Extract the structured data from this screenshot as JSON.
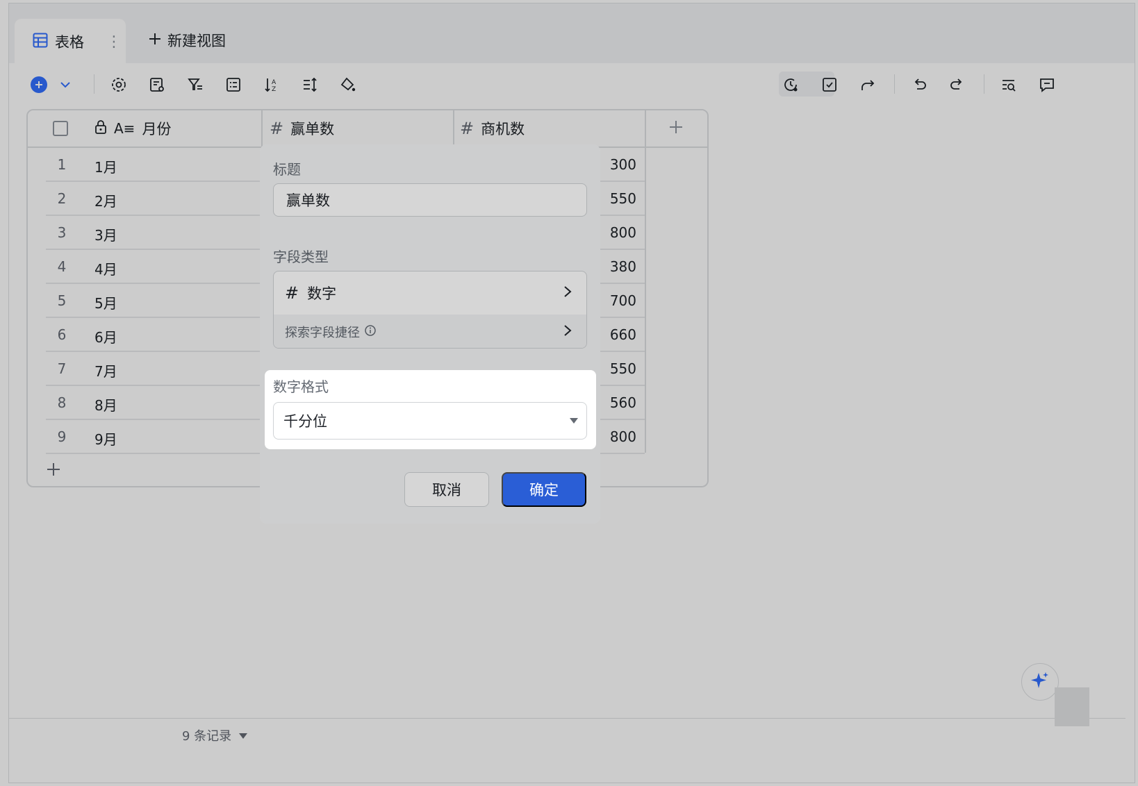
{
  "tabs": {
    "active_label": "表格",
    "new_view_label": "新建视图"
  },
  "grid": {
    "columns": [
      {
        "name": "月份"
      },
      {
        "name": "赢单数"
      },
      {
        "name": "商机数"
      }
    ],
    "rows": [
      {
        "num": "1",
        "month": "1月",
        "value": "300"
      },
      {
        "num": "2",
        "month": "2月",
        "value": "550"
      },
      {
        "num": "3",
        "month": "3月",
        "value": "800"
      },
      {
        "num": "4",
        "month": "4月",
        "value": "380"
      },
      {
        "num": "5",
        "month": "5月",
        "value": "700"
      },
      {
        "num": "6",
        "month": "6月",
        "value": "660"
      },
      {
        "num": "7",
        "month": "7月",
        "value": "550"
      },
      {
        "num": "8",
        "month": "8月",
        "value": "560"
      },
      {
        "num": "9",
        "month": "9月",
        "value": "800"
      }
    ]
  },
  "dialog": {
    "title_label": "标题",
    "title_value": "赢单数",
    "field_type_label": "字段类型",
    "field_type_value": "数字",
    "shortcut_label": "探索字段捷径",
    "number_format_label": "数字格式",
    "number_format_value": "千分位",
    "cancel_label": "取消",
    "ok_label": "确定"
  },
  "footer": {
    "records_label": "9 条记录"
  },
  "colors": {
    "primary": "#3370ff",
    "border": "#dee0e3",
    "text": "#1f2329",
    "muted": "#646a73"
  }
}
